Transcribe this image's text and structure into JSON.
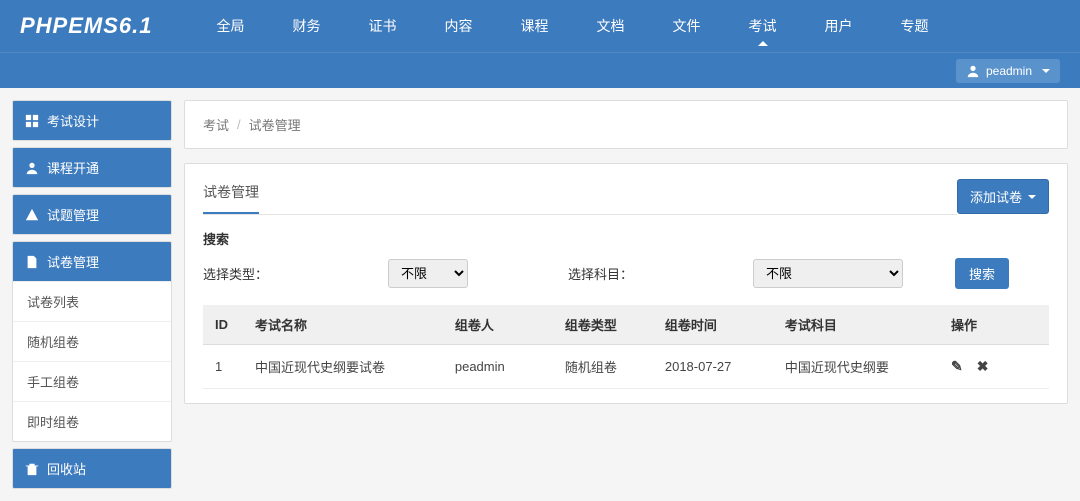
{
  "brand": "PHPEMS6.1",
  "nav": [
    "全局",
    "财务",
    "证书",
    "内容",
    "课程",
    "文档",
    "文件",
    "考试",
    "用户",
    "专题"
  ],
  "nav_active_index": 7,
  "user": "peadmin",
  "sidebar": [
    {
      "head": "考试设计",
      "icon": "grid",
      "subs": []
    },
    {
      "head": "课程开通",
      "icon": "user",
      "subs": []
    },
    {
      "head": "试题管理",
      "icon": "warn",
      "subs": []
    },
    {
      "head": "试卷管理",
      "icon": "file",
      "subs": [
        "试卷列表",
        "随机组卷",
        "手工组卷",
        "即时组卷"
      ]
    },
    {
      "head": "回收站",
      "icon": "trash",
      "subs": []
    }
  ],
  "breadcrumb": {
    "a": "考试",
    "b": "试卷管理"
  },
  "panel": {
    "title": "试卷管理",
    "add_label": "添加试卷",
    "search_header": "搜索",
    "type_label": "选择类型：",
    "type_option": "不限",
    "subject_label": "选择科目：",
    "subject_option": "不限",
    "search_btn": "搜索"
  },
  "table": {
    "headers": [
      "ID",
      "考试名称",
      "组卷人",
      "组卷类型",
      "组卷时间",
      "考试科目",
      "操作"
    ],
    "rows": [
      {
        "id": "1",
        "name": "中国近现代史纲要试卷",
        "author": "peadmin",
        "type": "随机组卷",
        "time": "2018-07-27",
        "subject": "中国近现代史纲要"
      }
    ]
  }
}
